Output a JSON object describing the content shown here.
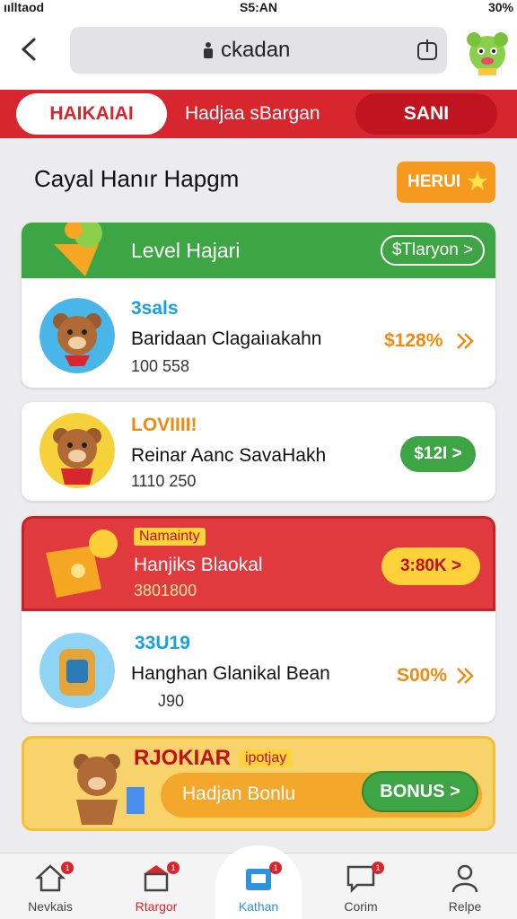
{
  "status_bar": {
    "carrier": "ıılltaod",
    "time": "S5:AN",
    "battery": "30%"
  },
  "browser": {
    "url": "ckadan"
  },
  "tabs": [
    {
      "label": "HAIKAIAI"
    },
    {
      "label": "Hadjaa sBargan"
    },
    {
      "label": "SANI"
    }
  ],
  "page": {
    "heading": "Cayal Hanır Hapgm",
    "heading_button": "HERUI"
  },
  "group1": {
    "header_title": "Level Hajari",
    "header_pill": "$Tlaryon >",
    "item": {
      "badge": "3sals",
      "title": "Baridaan Clagaiıakahn",
      "sub": "100  558",
      "price": "$128%"
    }
  },
  "card2": {
    "badge": "LOVIIII!",
    "title": "Reinar Aanc SavaHakh",
    "sub": "1110  250",
    "price": "$12I >"
  },
  "group3": {
    "tag": "Namainty",
    "header_title": "Hanjiks Blaokal",
    "header_sub": "3801800",
    "header_pill": "3:80K >",
    "item": {
      "badge": "33U19",
      "title": "Hanghan Glanikal Bean",
      "sub": "J90",
      "price": "S00%"
    }
  },
  "bonus": {
    "title": "RJOKIAR",
    "tag": "ipotjay",
    "label": "Hadjan Bonlu",
    "button": "BONUS >"
  },
  "nav": [
    {
      "label": "Nevkais",
      "badge": "1"
    },
    {
      "label": "Rtargor",
      "badge": "1"
    },
    {
      "label": "Kathan",
      "badge": "1"
    },
    {
      "label": "Corim",
      "badge": "1"
    },
    {
      "label": "Relpe"
    }
  ],
  "colors": {
    "brand_red": "#d8262e",
    "green": "#3ea545",
    "orange": "#f59a1e",
    "yellow": "#f8d26a"
  }
}
